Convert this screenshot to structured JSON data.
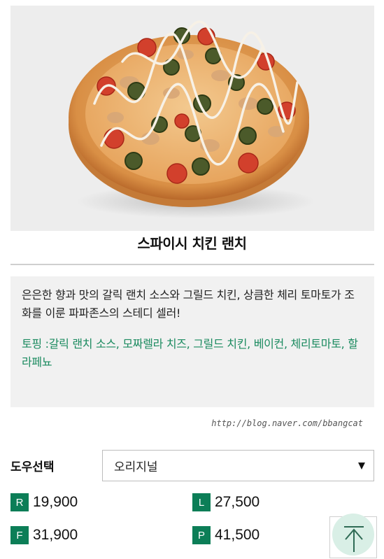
{
  "product": {
    "title": "스파이시 치킨 랜치",
    "image_icon": "pizza-image"
  },
  "description": {
    "text": "은은한 향과 맛의 갈릭 랜치 소스와 그릴드 치킨, 상큼한 체리 토마토가 조화를 이룬 파파존스의 스테디 셀러!",
    "topping": "토핑 :갈릭 랜치 소스, 모짜렐라 치즈, 그릴드 치킨, 베이컨, 체리토마토, 할라페뇨"
  },
  "watermark": "http://blog.naver.com/bbangcat",
  "dough": {
    "label": "도우선택",
    "selected": "오리지널"
  },
  "prices": [
    {
      "size": "R",
      "amount": "19,900"
    },
    {
      "size": "L",
      "amount": "27,500"
    },
    {
      "size": "F",
      "amount": "31,900"
    },
    {
      "size": "P",
      "amount": "41,500"
    }
  ],
  "colors": {
    "accent": "#0c7e57",
    "topping_text": "#1a8a5f",
    "desc_bg": "#f1f1f1"
  },
  "top_button_icon": "arrow-up-icon"
}
